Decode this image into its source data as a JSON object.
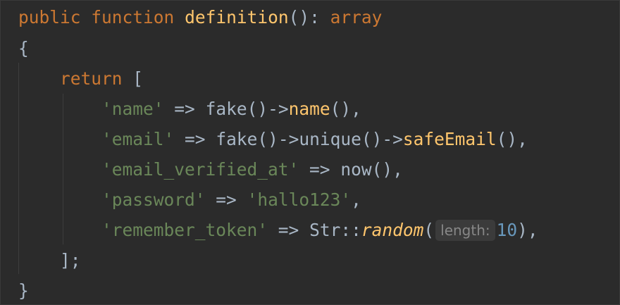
{
  "code": {
    "l1": {
      "kw1": "public",
      "kw2": "function",
      "fn": "definition",
      "rest": "():",
      "type": "array"
    },
    "l2": {
      "text": "{"
    },
    "l3": {
      "kw": "return",
      "bracket": "["
    },
    "l4": {
      "key": "'name'",
      "arrow": "=>",
      "call1": "fake",
      "mid": "()->",
      "call2": "name",
      "end": "(),"
    },
    "l5": {
      "key": "'email'",
      "arrow": "=>",
      "call1": "fake",
      "mid1": "()->",
      "call2": "unique",
      "mid2": "()->",
      "call3": "safeEmail",
      "end": "(),"
    },
    "l6": {
      "key": "'email_verified_at'",
      "arrow": "=>",
      "call": "now",
      "end": "(),"
    },
    "l7": {
      "key": "'password'",
      "arrow": "=>",
      "value": "'hallo123'",
      "comma": ","
    },
    "l8": {
      "key": "'remember_token'",
      "arrow": "=>",
      "cls": "Str",
      "sep": "::",
      "method": "random",
      "open": "(",
      "hint": "length:",
      "num": "10",
      "end": "),"
    },
    "l9": {
      "text": "];"
    },
    "l10": {
      "text": "}"
    }
  }
}
